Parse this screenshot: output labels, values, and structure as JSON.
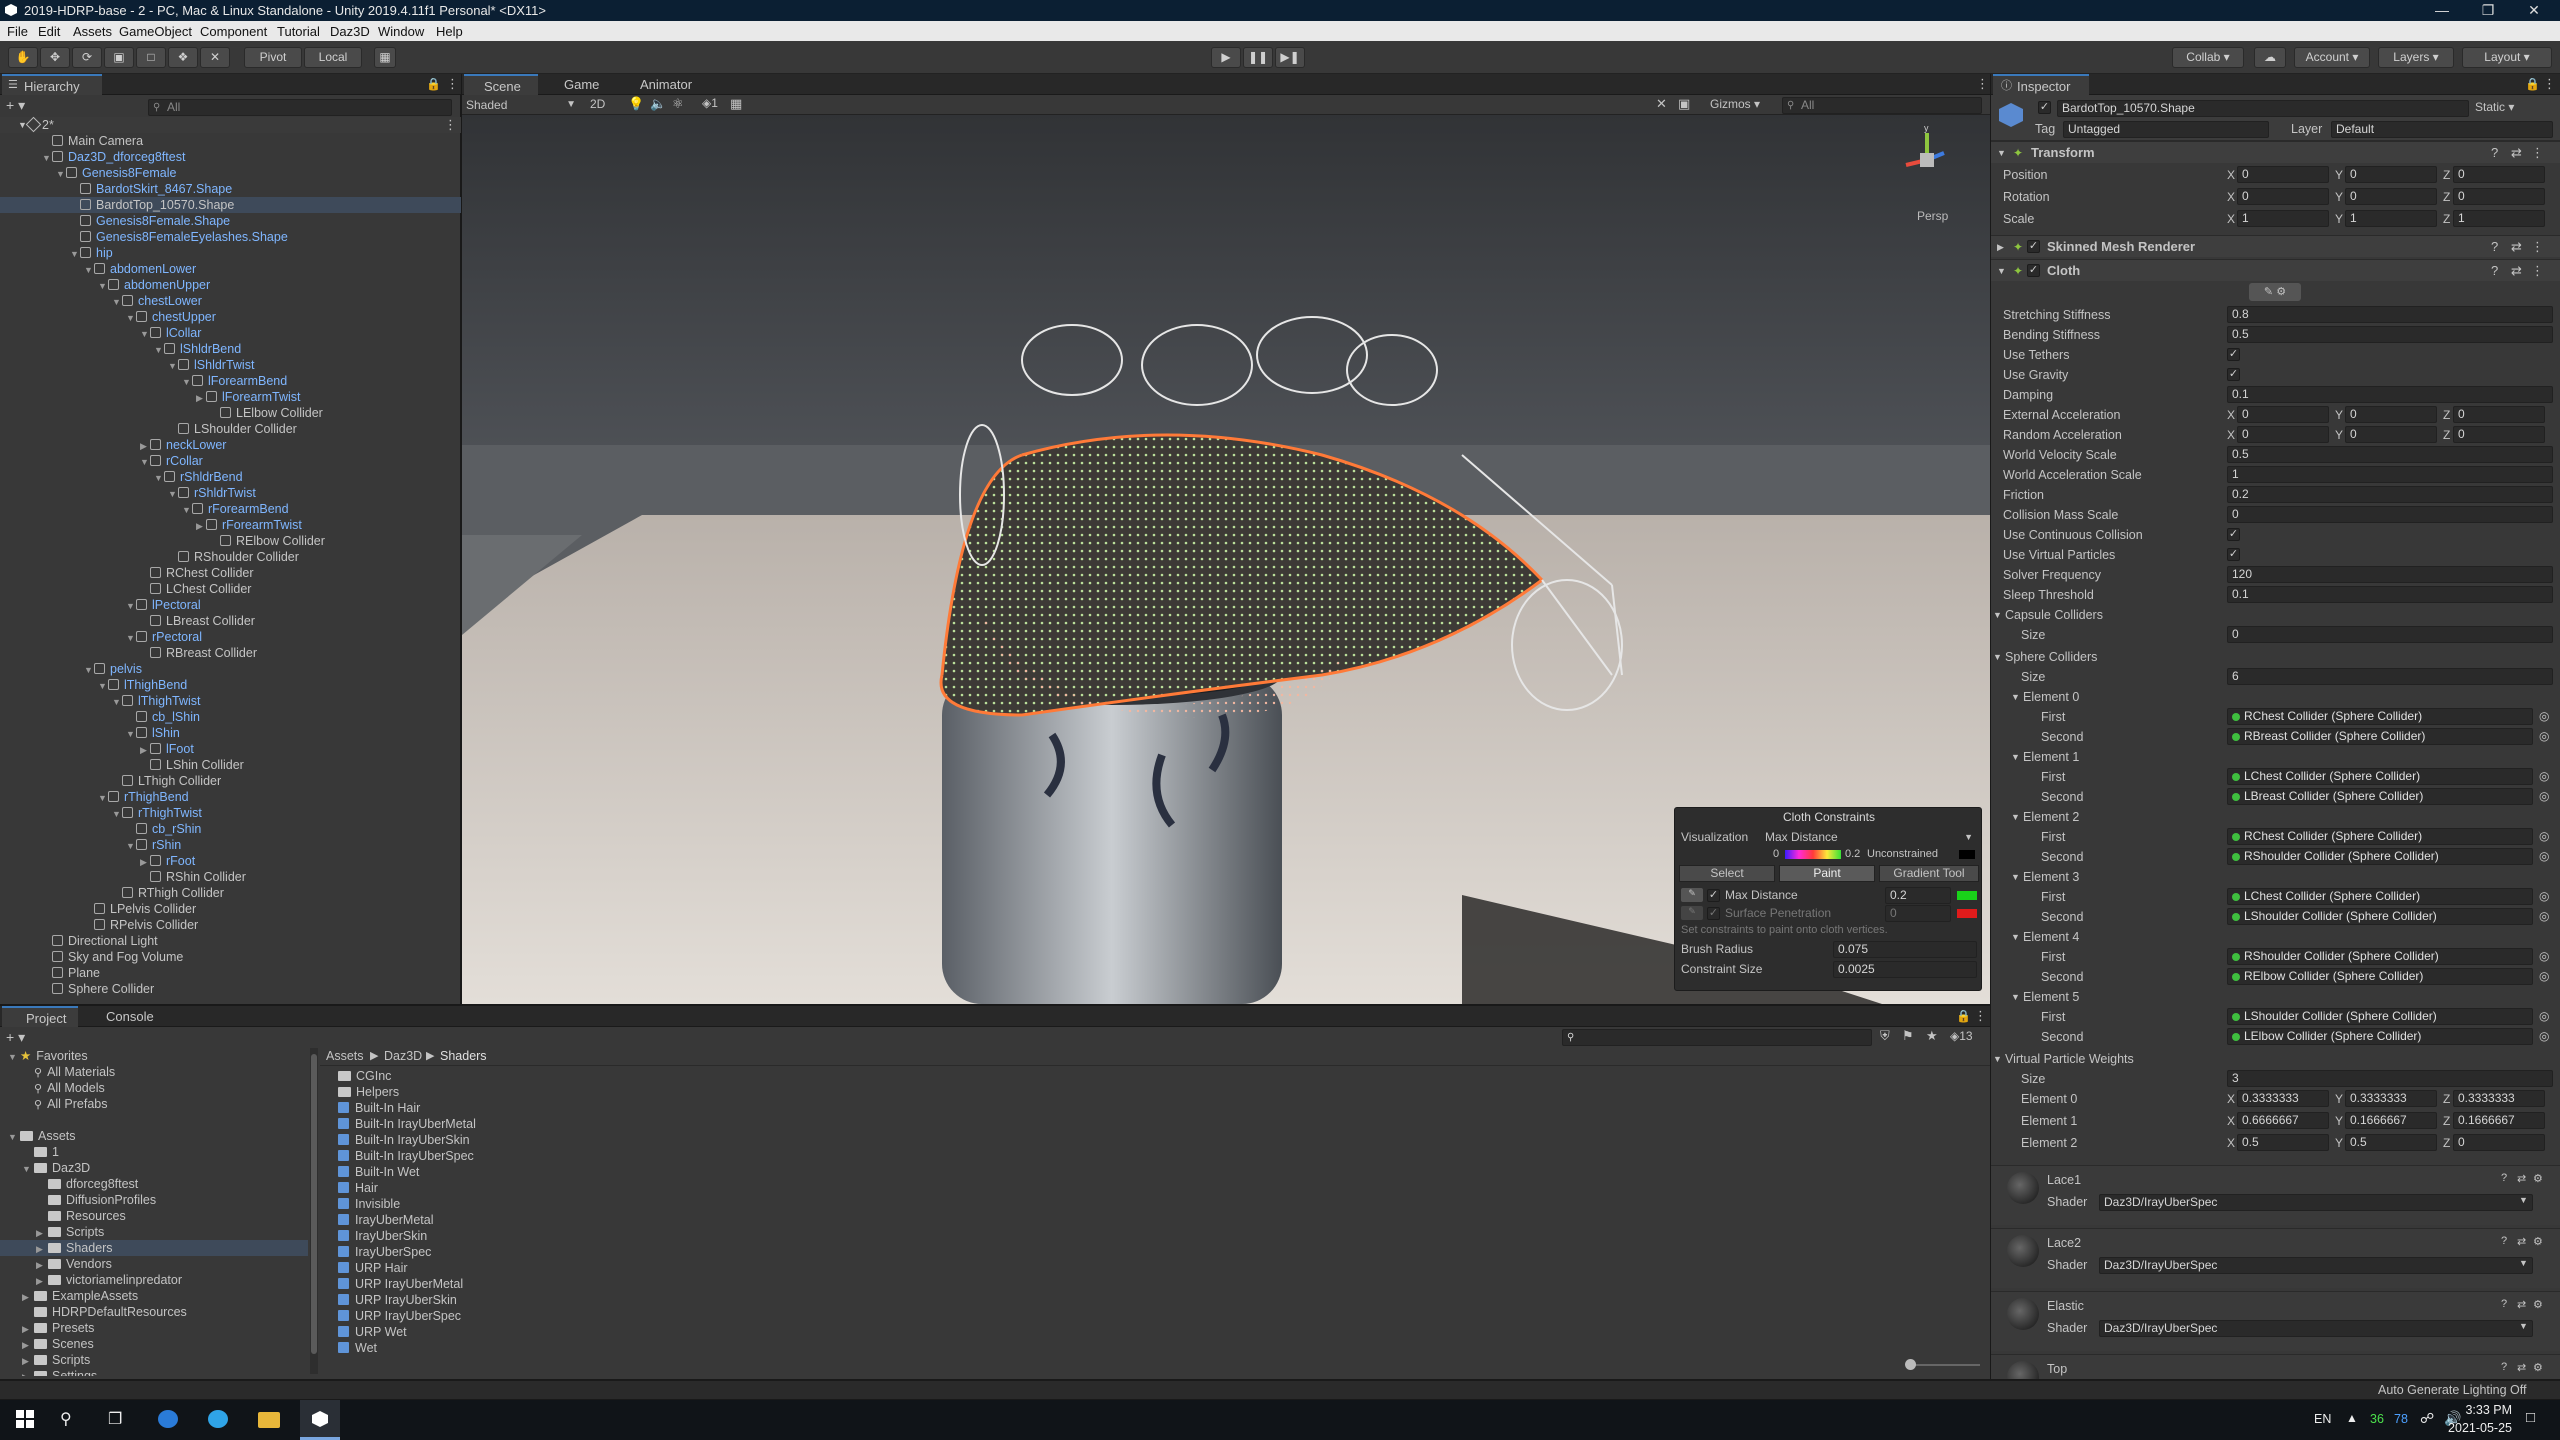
{
  "window": {
    "title": "2019-HDRP-base - 2 - PC, Mac & Linux Standalone - Unity 2019.4.11f1 Personal* <DX11>"
  },
  "menu": [
    "File",
    "Edit",
    "Assets",
    "GameObject",
    "Component",
    "Tutorial",
    "Daz3D",
    "Window",
    "Help"
  ],
  "toolbar": {
    "pivot": "Pivot",
    "local": "Local",
    "collab": "Collab",
    "account": "Account",
    "layers": "Layers",
    "layout": "Layout"
  },
  "hierarchy": {
    "tab": "Hierarchy",
    "search": "All",
    "scene": "2*",
    "items": [
      {
        "d": 1,
        "t": "Main Camera",
        "b": false
      },
      {
        "d": 1,
        "t": "Daz3D_dforceg8ftest",
        "b": true,
        "a": "v"
      },
      {
        "d": 2,
        "t": "Genesis8Female",
        "b": true,
        "a": "v"
      },
      {
        "d": 3,
        "t": "BardotSkirt_8467.Shape",
        "b": true
      },
      {
        "d": 3,
        "t": "BardotTop_10570.Shape",
        "b": false,
        "sel": true
      },
      {
        "d": 3,
        "t": "Genesis8Female.Shape",
        "b": true
      },
      {
        "d": 3,
        "t": "Genesis8FemaleEyelashes.Shape",
        "b": true
      },
      {
        "d": 3,
        "t": "hip",
        "b": true,
        "a": "v"
      },
      {
        "d": 4,
        "t": "abdomenLower",
        "b": true,
        "a": "v"
      },
      {
        "d": 5,
        "t": "abdomenUpper",
        "b": true,
        "a": "v"
      },
      {
        "d": 6,
        "t": "chestLower",
        "b": true,
        "a": "v"
      },
      {
        "d": 7,
        "t": "chestUpper",
        "b": true,
        "a": "v"
      },
      {
        "d": 8,
        "t": "lCollar",
        "b": true,
        "a": "v"
      },
      {
        "d": 9,
        "t": "lShldrBend",
        "b": true,
        "a": "v"
      },
      {
        "d": 10,
        "t": "lShldrTwist",
        "b": true,
        "a": "v"
      },
      {
        "d": 11,
        "t": "lForearmBend",
        "b": true,
        "a": "v"
      },
      {
        "d": 12,
        "t": "lForearmTwist",
        "b": true,
        "a": ">"
      },
      {
        "d": 13,
        "t": "LElbow Collider",
        "b": false
      },
      {
        "d": 10,
        "t": "LShoulder Collider",
        "b": false
      },
      {
        "d": 8,
        "t": "neckLower",
        "b": true,
        "a": ">"
      },
      {
        "d": 8,
        "t": "rCollar",
        "b": true,
        "a": "v"
      },
      {
        "d": 9,
        "t": "rShldrBend",
        "b": true,
        "a": "v"
      },
      {
        "d": 10,
        "t": "rShldrTwist",
        "b": true,
        "a": "v"
      },
      {
        "d": 11,
        "t": "rForearmBend",
        "b": true,
        "a": "v"
      },
      {
        "d": 12,
        "t": "rForearmTwist",
        "b": true,
        "a": ">"
      },
      {
        "d": 13,
        "t": "RElbow Collider",
        "b": false
      },
      {
        "d": 10,
        "t": "RShoulder Collider",
        "b": false
      },
      {
        "d": 8,
        "t": "RChest Collider",
        "b": false
      },
      {
        "d": 8,
        "t": "LChest Collider",
        "b": false
      },
      {
        "d": 7,
        "t": "lPectoral",
        "b": true,
        "a": "v"
      },
      {
        "d": 8,
        "t": "LBreast Collider",
        "b": false
      },
      {
        "d": 7,
        "t": "rPectoral",
        "b": true,
        "a": "v"
      },
      {
        "d": 8,
        "t": "RBreast Collider",
        "b": false
      },
      {
        "d": 4,
        "t": "pelvis",
        "b": true,
        "a": "v"
      },
      {
        "d": 5,
        "t": "lThighBend",
        "b": true,
        "a": "v"
      },
      {
        "d": 6,
        "t": "lThighTwist",
        "b": true,
        "a": "v"
      },
      {
        "d": 7,
        "t": "cb_lShin",
        "b": true
      },
      {
        "d": 7,
        "t": "lShin",
        "b": true,
        "a": "v"
      },
      {
        "d": 8,
        "t": "lFoot",
        "b": true,
        "a": ">"
      },
      {
        "d": 8,
        "t": "LShin Collider",
        "b": false
      },
      {
        "d": 6,
        "t": "LThigh Collider",
        "b": false
      },
      {
        "d": 5,
        "t": "rThighBend",
        "b": true,
        "a": "v"
      },
      {
        "d": 6,
        "t": "rThighTwist",
        "b": true,
        "a": "v"
      },
      {
        "d": 7,
        "t": "cb_rShin",
        "b": true
      },
      {
        "d": 7,
        "t": "rShin",
        "b": true,
        "a": "v"
      },
      {
        "d": 8,
        "t": "rFoot",
        "b": true,
        "a": ">"
      },
      {
        "d": 8,
        "t": "RShin Collider",
        "b": false
      },
      {
        "d": 6,
        "t": "RThigh Collider",
        "b": false
      },
      {
        "d": 4,
        "t": "LPelvis Collider",
        "b": false
      },
      {
        "d": 4,
        "t": "RPelvis Collider",
        "b": false
      },
      {
        "d": 1,
        "t": "Directional Light",
        "b": false
      },
      {
        "d": 1,
        "t": "Sky and Fog Volume",
        "b": false
      },
      {
        "d": 1,
        "t": "Plane",
        "b": false
      },
      {
        "d": 1,
        "t": "Sphere Collider",
        "b": false
      }
    ]
  },
  "scene": {
    "tabs": [
      "Scene",
      "Game",
      "Animator"
    ],
    "shading": "Shaded",
    "mode2d": "2D",
    "gizmos": "Gizmos",
    "search": "All",
    "persp": "Persp"
  },
  "cloth_constraints": {
    "title": "Cloth Constraints",
    "viz_label": "Visualization",
    "viz_value": "Max Distance",
    "grad_min": "0",
    "grad_max": "0.2",
    "unconstrained": "Unconstrained",
    "btn_select": "Select",
    "btn_paint": "Paint",
    "btn_gradient": "Gradient Tool",
    "max_distance_label": "Max Distance",
    "max_distance_value": "0.2",
    "surface_pen_label": "Surface Penetration",
    "surface_pen_value": "0",
    "hint": "Set constraints to paint onto cloth vertices.",
    "brush_radius_label": "Brush Radius",
    "brush_radius_value": "0.075",
    "constraint_size_label": "Constraint Size",
    "constraint_size_value": "0.0025",
    "colors": {
      "max": "#19d219",
      "pen": "#e01b1b"
    }
  },
  "inspector": {
    "tab": "Inspector",
    "object_name": "BardotTop_10570.Shape",
    "static": "Static",
    "tag_label": "Tag",
    "tag_value": "Untagged",
    "layer_label": "Layer",
    "layer_value": "Default",
    "transform": {
      "title": "Transform",
      "rows": [
        {
          "label": "Position",
          "x": "0",
          "y": "0",
          "z": "0"
        },
        {
          "label": "Rotation",
          "x": "0",
          "y": "0",
          "z": "0"
        },
        {
          "label": "Scale",
          "x": "1",
          "y": "1",
          "z": "1"
        }
      ]
    },
    "smr": {
      "title": "Skinned Mesh Renderer"
    },
    "cloth": {
      "title": "Cloth",
      "fields": [
        {
          "label": "Stretching Stiffness",
          "value": "0.8"
        },
        {
          "label": "Bending Stiffness",
          "value": "0.5"
        },
        {
          "label": "Use Tethers",
          "check": true
        },
        {
          "label": "Use Gravity",
          "check": true
        },
        {
          "label": "Damping",
          "value": "0.1"
        },
        {
          "label": "External Acceleration",
          "x": "0",
          "y": "0",
          "z": "0"
        },
        {
          "label": "Random Acceleration",
          "x": "0",
          "y": "0",
          "z": "0"
        },
        {
          "label": "World Velocity Scale",
          "value": "0.5"
        },
        {
          "label": "World Acceleration Scale",
          "value": "1"
        },
        {
          "label": "Friction",
          "value": "0.2"
        },
        {
          "label": "Collision Mass Scale",
          "value": "0"
        },
        {
          "label": "Use Continuous Collision",
          "check": true
        },
        {
          "label": "Use Virtual Particles",
          "check": true
        },
        {
          "label": "Solver Frequency",
          "value": "120"
        },
        {
          "label": "Sleep Threshold",
          "value": "0.1"
        }
      ],
      "capsule_label": "Capsule Colliders",
      "capsule_size_label": "Size",
      "capsule_size": "0",
      "sphere_label": "Sphere Colliders",
      "sphere_size_label": "Size",
      "sphere_size": "6",
      "first_label": "First",
      "second_label": "Second",
      "elements": [
        {
          "name": "Element 0",
          "first": "RChest Collider (Sphere Collider)",
          "second": "RBreast Collider (Sphere Collider)"
        },
        {
          "name": "Element 1",
          "first": "LChest Collider (Sphere Collider)",
          "second": "LBreast Collider (Sphere Collider)"
        },
        {
          "name": "Element 2",
          "first": "RChest Collider (Sphere Collider)",
          "second": "RShoulder Collider (Sphere Collider)"
        },
        {
          "name": "Element 3",
          "first": "LChest Collider (Sphere Collider)",
          "second": "LShoulder Collider (Sphere Collider)"
        },
        {
          "name": "Element 4",
          "first": "RShoulder Collider (Sphere Collider)",
          "second": "RElbow Collider (Sphere Collider)"
        },
        {
          "name": "Element 5",
          "first": "LShoulder Collider (Sphere Collider)",
          "second": "LElbow Collider (Sphere Collider)"
        }
      ],
      "vpw_label": "Virtual Particle Weights",
      "vpw_size_label": "Size",
      "vpw_size": "3",
      "vpw": [
        {
          "name": "Element 0",
          "x": "0.3333333",
          "y": "0.3333333",
          "z": "0.3333333"
        },
        {
          "name": "Element 1",
          "x": "0.6666667",
          "y": "0.1666667",
          "z": "0.1666667"
        },
        {
          "name": "Element 2",
          "x": "0.5",
          "y": "0.5",
          "z": "0"
        }
      ]
    },
    "materials": [
      {
        "name": "Lace1",
        "shader": "Daz3D/IrayUberSpec"
      },
      {
        "name": "Lace2",
        "shader": "Daz3D/IrayUberSpec"
      },
      {
        "name": "Elastic",
        "shader": "Daz3D/IrayUberSpec"
      },
      {
        "name": "Top",
        "shader": ""
      }
    ],
    "shader_label": "Shader"
  },
  "project": {
    "tabs": [
      "Project",
      "Console"
    ],
    "count": "13",
    "breadcrumb": [
      "Assets",
      "Daz3D",
      "Shaders"
    ],
    "left": [
      {
        "d": 0,
        "t": "Favorites",
        "k": "star",
        "a": "v"
      },
      {
        "d": 1,
        "t": "All Materials",
        "k": "search"
      },
      {
        "d": 1,
        "t": "All Models",
        "k": "search"
      },
      {
        "d": 1,
        "t": "All Prefabs",
        "k": "search"
      },
      {
        "d": 0,
        "t": "",
        "k": "blank"
      },
      {
        "d": 0,
        "t": "Assets",
        "k": "folder",
        "a": "v"
      },
      {
        "d": 1,
        "t": "1",
        "k": "folder"
      },
      {
        "d": 1,
        "t": "Daz3D",
        "k": "folder",
        "a": "v"
      },
      {
        "d": 2,
        "t": "dforceg8ftest",
        "k": "folder"
      },
      {
        "d": 2,
        "t": "DiffusionProfiles",
        "k": "folder"
      },
      {
        "d": 2,
        "t": "Resources",
        "k": "folder"
      },
      {
        "d": 2,
        "t": "Scripts",
        "k": "folder",
        "a": ">"
      },
      {
        "d": 2,
        "t": "Shaders",
        "k": "folder",
        "a": ">",
        "sel": true
      },
      {
        "d": 2,
        "t": "Vendors",
        "k": "folder",
        "a": ">"
      },
      {
        "d": 2,
        "t": "victoriamelinpredator",
        "k": "folder",
        "a": ">"
      },
      {
        "d": 1,
        "t": "ExampleAssets",
        "k": "folder",
        "a": ">"
      },
      {
        "d": 1,
        "t": "HDRPDefaultResources",
        "k": "folder"
      },
      {
        "d": 1,
        "t": "Presets",
        "k": "folder",
        "a": ">"
      },
      {
        "d": 1,
        "t": "Scenes",
        "k": "folder",
        "a": ">"
      },
      {
        "d": 1,
        "t": "Scripts",
        "k": "folder",
        "a": ">"
      },
      {
        "d": 1,
        "t": "Settings",
        "k": "folder",
        "a": ">"
      }
    ],
    "right": [
      {
        "t": "CGInc",
        "k": "folder"
      },
      {
        "t": "Helpers",
        "k": "folder"
      },
      {
        "t": "Built-In Hair",
        "k": "shader"
      },
      {
        "t": "Built-In IrayUberMetal",
        "k": "shader"
      },
      {
        "t": "Built-In IrayUberSkin",
        "k": "shader"
      },
      {
        "t": "Built-In IrayUberSpec",
        "k": "shader"
      },
      {
        "t": "Built-In Wet",
        "k": "shader"
      },
      {
        "t": "Hair",
        "k": "shader"
      },
      {
        "t": "Invisible",
        "k": "shader"
      },
      {
        "t": "IrayUberMetal",
        "k": "shader"
      },
      {
        "t": "IrayUberSkin",
        "k": "shader"
      },
      {
        "t": "IrayUberSpec",
        "k": "shader"
      },
      {
        "t": "URP Hair",
        "k": "shader"
      },
      {
        "t": "URP IrayUberMetal",
        "k": "shader"
      },
      {
        "t": "URP IrayUberSkin",
        "k": "shader"
      },
      {
        "t": "URP IrayUberSpec",
        "k": "shader"
      },
      {
        "t": "URP Wet",
        "k": "shader"
      },
      {
        "t": "Wet",
        "k": "shader"
      }
    ]
  },
  "status": {
    "text": "Auto Generate Lighting Off"
  },
  "taskbar": {
    "lang": "EN",
    "temp1": "36",
    "temp2": "78",
    "time": "3:33 PM",
    "date": "2021-05-25"
  }
}
